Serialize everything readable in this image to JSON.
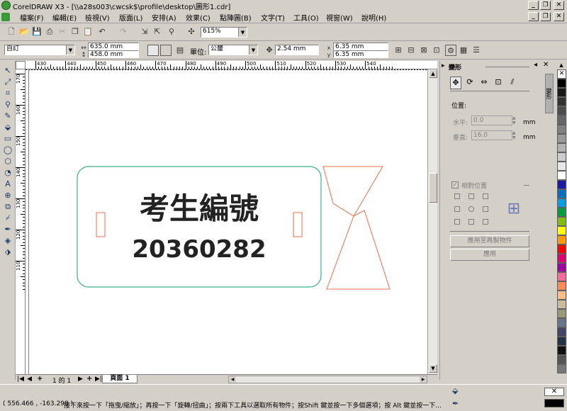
{
  "window": {
    "title": "CorelDRAW X3 - [\\\\a28s003\\cwcsk$\\profile\\desktop\\圖形1.cdr]",
    "min": "_",
    "restore": "❐",
    "close": "✕"
  },
  "menu": [
    "檔案(F)",
    "編輯(E)",
    "檢視(V)",
    "版面(L)",
    "安排(A)",
    "效果(C)",
    "點陣圖(B)",
    "文字(T)",
    "工具(O)",
    "視窗(W)",
    "說明(H)"
  ],
  "toolbar": {
    "zoom": "615%"
  },
  "propertybar": {
    "preset": "自訂",
    "page_width": "635.0 mm",
    "page_height": "458.0 mm",
    "units_label": "單位:",
    "units": "公釐",
    "nudge": "2.54 mm",
    "dup_x": "6.35 mm",
    "dup_y": "6.35 mm"
  },
  "ruler": {
    "unit": "公釐",
    "h_labels": [
      "430",
      "440",
      "450",
      "460",
      "470",
      "480",
      "490",
      "500",
      "510",
      "520",
      "530",
      "540"
    ],
    "v_labels": [
      "170",
      "160",
      "150",
      "140",
      "130",
      "120",
      "110"
    ]
  },
  "canvas": {
    "badge_title": "考生編號",
    "badge_number": "20360282"
  },
  "page_nav": {
    "count": "1 的 1",
    "tab": "頁面 1"
  },
  "docker": {
    "title": "變形",
    "section": "位置:",
    "h_label": "水平:",
    "h_value": "0.0",
    "v_label": "垂直:",
    "v_value": "16.0",
    "unit": "mm",
    "relative": "相對位置",
    "apply_dup": "應用至再製物件",
    "apply": "應用"
  },
  "palette": [
    "#ffffff",
    "#000000",
    "#1a1a1a",
    "#333333",
    "#4d4d4d",
    "#666666",
    "#808080",
    "#999999",
    "#b3b3b3",
    "#cccccc",
    "#e6e6e6",
    "#ffffff",
    "#1a1aa8",
    "#0070c0",
    "#00a0e0",
    "#00a040",
    "#80c000",
    "#ffff00",
    "#ff9900",
    "#ff0000",
    "#e0006e",
    "#a000a0",
    "#ff6699",
    "#ff8855",
    "#ffbb88",
    "#ccbb99",
    "#999977",
    "#667788",
    "#444466",
    "#223344",
    "#111111",
    "#555555",
    "#777777"
  ],
  "status": {
    "coords": "( 556.466 , -163.298 )",
    "hint": "接下來按一下「拖曳/縮放」；再按一下「旋轉/扭曲」；按兩下工具以選取所有物件；按Shift 鍵並按一下多個選項；按 Alt 鍵並按一下..."
  },
  "colors": {
    "badge_outline": "#3cb085",
    "accent_outline": "#e8704a"
  }
}
